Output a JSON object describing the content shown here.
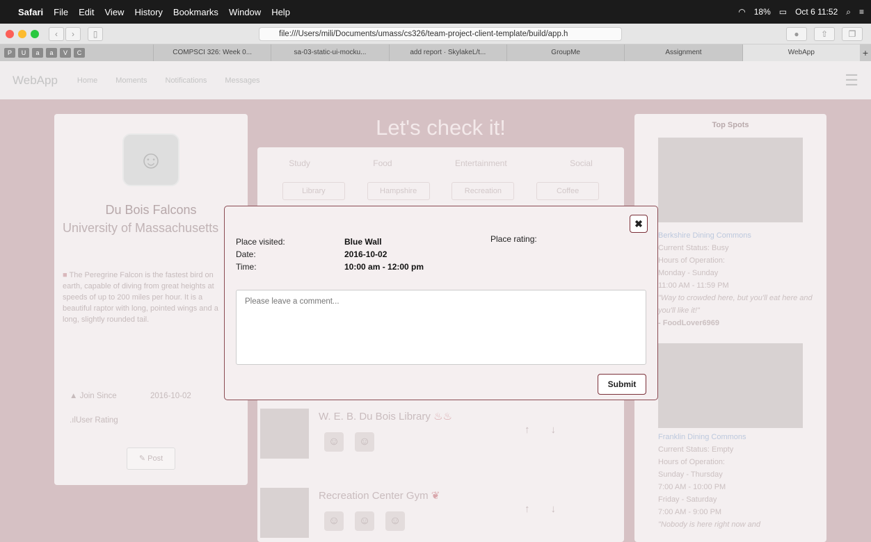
{
  "menubar": {
    "app": "Safari",
    "items": [
      "File",
      "Edit",
      "View",
      "History",
      "Bookmarks",
      "Window",
      "Help"
    ],
    "battery": "18%",
    "clock": "Oct 6  11:52"
  },
  "browser": {
    "url": "file:///Users/mili/Documents/umass/cs326/team-project-client-template/build/app.h",
    "tabs": [
      "COMPSCI 326: Week 0...",
      "sa-03-static-ui-mocku...",
      "add report · SkylakeL/t...",
      "GroupMe",
      "Assignment",
      "WebApp"
    ]
  },
  "appnav": {
    "brand": "WebApp",
    "links": [
      "Home",
      "Moments",
      "Notifications",
      "Messages"
    ]
  },
  "profile": {
    "name": "Du Bois Falcons",
    "university": "University of Massachusetts",
    "bio": "The Peregrine Falcon is the fastest bird on earth, capable of diving from great heights at speeds of up to 200 miles per hour. It is a beautiful raptor with long, pointed wings and a long, slightly rounded tail.",
    "join_label": "Join Since",
    "join_value": "2016-10-02",
    "rating_label": "User Rating",
    "post_label": "Post"
  },
  "main": {
    "heading": "Let's check it!",
    "categories": [
      "Study",
      "Food",
      "Entertainment",
      "Social"
    ],
    "subcategories": [
      "Library",
      "Hampshire",
      "Recreation",
      "Coffee"
    ],
    "places": [
      {
        "title": "W. E. B. Du Bois Library",
        "faces": 2
      },
      {
        "title": "Recreation Center Gym",
        "faces": 3
      }
    ]
  },
  "topspots": {
    "title": "Top Spots",
    "spots": [
      {
        "name": "Berkshire Dining Commons",
        "status": "Current Status: Busy",
        "hours_label": "Hours of Operation:",
        "days": "Monday - Sunday",
        "hours": "11:00 AM - 11:59 PM",
        "quote": "\"Way to crowded here, but you'll eat here and you'll like it!\"",
        "author": "- FoodLover6969"
      },
      {
        "name": "Franklin Dining Commons",
        "status": "Current Status: Empty",
        "hours_label": "Hours of Operation:",
        "days": "Sunday - Thursday",
        "hours": "7:00 AM - 10:00 PM",
        "days2": "Friday - Saturday",
        "hours2": "7:00 AM - 9:00 PM",
        "quote": "\"Nobody is here right now and"
      }
    ]
  },
  "modal": {
    "close": "✖",
    "place_label": "Place visited:",
    "place_value": "Blue Wall",
    "date_label": "Date:",
    "date_value": "2016-10-02",
    "time_label": "Time:",
    "time_value": "10:00 am - 12:00 pm",
    "rating_label": "Place rating:",
    "comment_placeholder": "Please leave a comment...",
    "submit": "Submit"
  }
}
